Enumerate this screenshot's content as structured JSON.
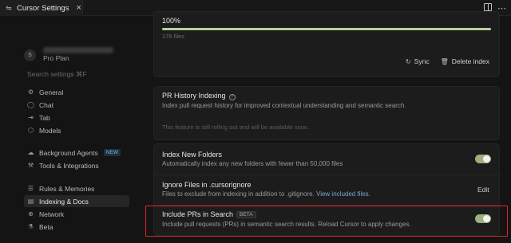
{
  "window": {
    "tab_title": "Cursor Settings",
    "tab_icon": "settings-icon",
    "close_icon": "×",
    "more_icon": "⋯"
  },
  "sidebar": {
    "avatar_initial": "S",
    "plan": "Pro Plan",
    "search_placeholder": "Search settings ⌘F",
    "items": [
      {
        "label": "General",
        "icon": "gear-icon",
        "glyph": "⚙"
      },
      {
        "label": "Chat",
        "icon": "chat-icon",
        "glyph": "◯"
      },
      {
        "label": "Tab",
        "icon": "tab-icon",
        "glyph": "⇥"
      },
      {
        "label": "Models",
        "icon": "cube-icon",
        "glyph": "⬡"
      },
      {
        "label": "Background Agents",
        "icon": "cloud-icon",
        "glyph": "☁",
        "badge": "NEW"
      },
      {
        "label": "Tools & Integrations",
        "icon": "tools-icon",
        "glyph": "⚒"
      },
      {
        "label": "Rules & Memories",
        "icon": "rules-icon",
        "glyph": "☰"
      },
      {
        "label": "Indexing & Docs",
        "icon": "database-icon",
        "glyph": "▤"
      },
      {
        "label": "Network",
        "icon": "globe-icon",
        "glyph": "⊕"
      },
      {
        "label": "Beta",
        "icon": "beta-icon",
        "glyph": "⚗"
      }
    ],
    "active_index": 7
  },
  "indexing": {
    "progress_label": "100%",
    "progress_value": 100,
    "files_count": "176 files",
    "sync_label": "Sync",
    "delete_label": "Delete index",
    "progress_color": "#b9cf9a"
  },
  "pr_history": {
    "title": "PR History Indexing",
    "desc": "Index pull request history for improved contextual understanding and semantic search.",
    "note": "This feature is still rolling out and will be available soon."
  },
  "settings": {
    "index_new_folders_title": "Index New Folders",
    "index_new_folders_desc": "Automatically index any new folders with fewer than 50,000 files",
    "index_new_folders_on": true,
    "ignore_title": "Ignore Files in .cursorignore",
    "ignore_desc": "Files to exclude from indexing in addition to .gitignore.",
    "ignore_link": "View included files.",
    "edit_label": "Edit",
    "include_prs_title": "Include PRs in Search",
    "include_prs_badge": "BETA",
    "include_prs_desc": "Include pull requests (PRs) in semantic search results. Reload Cursor to apply changes.",
    "include_prs_on": true
  },
  "colors": {
    "toggle_on": "#9db07f",
    "highlight": "#e0242a",
    "link": "#7aa7cf"
  }
}
